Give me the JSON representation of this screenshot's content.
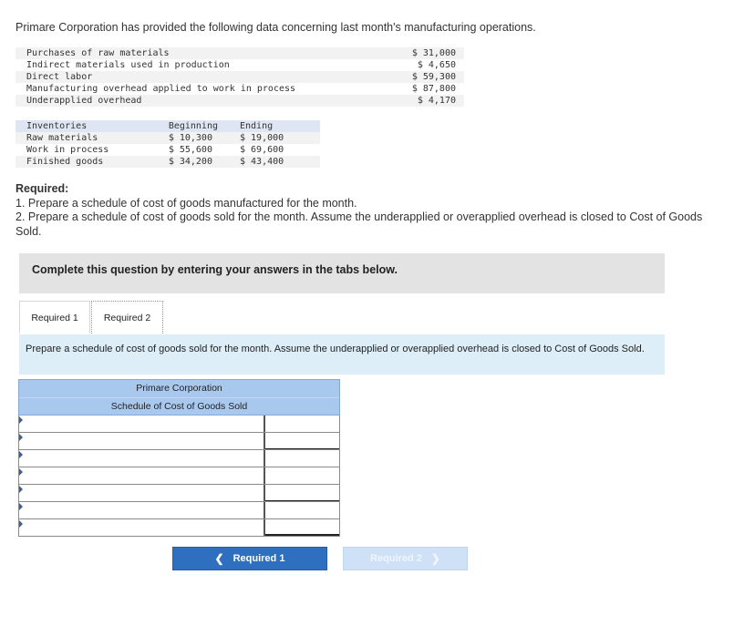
{
  "intro": "Primare Corporation has provided the following data concerning last month's manufacturing operations.",
  "cost_data": [
    {
      "label": "Purchases of raw materials",
      "amount": "$ 31,000"
    },
    {
      "label": "Indirect materials used in production",
      "amount": "$ 4,650"
    },
    {
      "label": "Direct labor",
      "amount": "$ 59,300"
    },
    {
      "label": "Manufacturing overhead applied to work in process",
      "amount": "$ 87,800"
    },
    {
      "label": "Underapplied overhead",
      "amount": "$ 4,170"
    }
  ],
  "inventories": {
    "headers": [
      "Inventories",
      "Beginning",
      "Ending"
    ],
    "rows": [
      {
        "label": "Raw materials",
        "beginning": "$ 10,300",
        "ending": "$ 19,000"
      },
      {
        "label": "Work in process",
        "beginning": "$ 55,600",
        "ending": "$ 69,600"
      },
      {
        "label": "Finished goods",
        "beginning": "$ 34,200",
        "ending": "$ 43,400"
      }
    ]
  },
  "required": {
    "heading": "Required:",
    "item1": "1. Prepare a schedule of cost of goods manufactured for the month.",
    "item2": "2. Prepare a schedule of cost of goods sold for the month. Assume the underapplied or overapplied overhead is closed to Cost of Goods Sold."
  },
  "banner": "Complete this question by entering your answers in the tabs below.",
  "tabs": [
    {
      "label": "Required 1"
    },
    {
      "label": "Required 2"
    }
  ],
  "instruction": "Prepare a schedule of cost of goods sold for the month. Assume the underapplied or overapplied overhead is closed to Cost of Goods Sold.",
  "schedule": {
    "company": "Primare Corporation",
    "title": "Schedule of Cost of Goods Sold"
  },
  "nav": {
    "prev_label": "Required 1",
    "next_label": "Required 2",
    "prev_icon": "chevron-left-icon",
    "next_icon": "chevron-right-icon",
    "prev_color": "#2f6fbf",
    "next_color": "#cfe1f6"
  }
}
